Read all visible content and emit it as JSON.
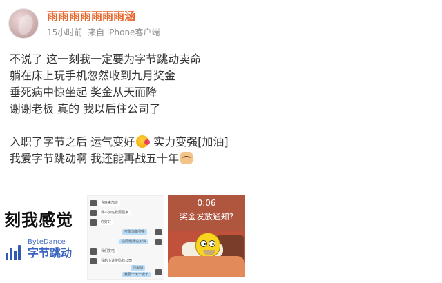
{
  "post": {
    "author": "雨雨雨雨雨雨雨涵",
    "time": "15小时前",
    "source": "来自 iPhone客户端",
    "lines": [
      "不说了 这一刻我一定要为字节跳动卖命",
      "躺在床上玩手机忽然收到九月奖金",
      "垂死病中惊坐起 奖金从天而降",
      "谢谢老板 真的 我以后住公司了"
    ],
    "line5_a": "入职了字节之后 运气变好",
    "line5_b": " 实力变强[加油]",
    "line6": "我爱字节跳动啊 我还能再战五十年",
    "emoji_1": "blush-emoji",
    "emoji_2": "cat-emoji"
  },
  "images": {
    "image1": {
      "caption": "刻我感觉",
      "logo_en": "ByteDance",
      "logo_zh": "字节跳动"
    },
    "image2": {
      "messages": [
        "今晚来加班",
        "我不加班我要回家",
        "你好好",
        "可能你偷奖金",
        "没问题我说加油",
        "我们发啦",
        "我的小说奖励的公司",
        "你加油",
        "我要一天一夜干"
      ]
    },
    "image3": {
      "time": "0:06",
      "notification": "奖金发放通知?"
    }
  }
}
